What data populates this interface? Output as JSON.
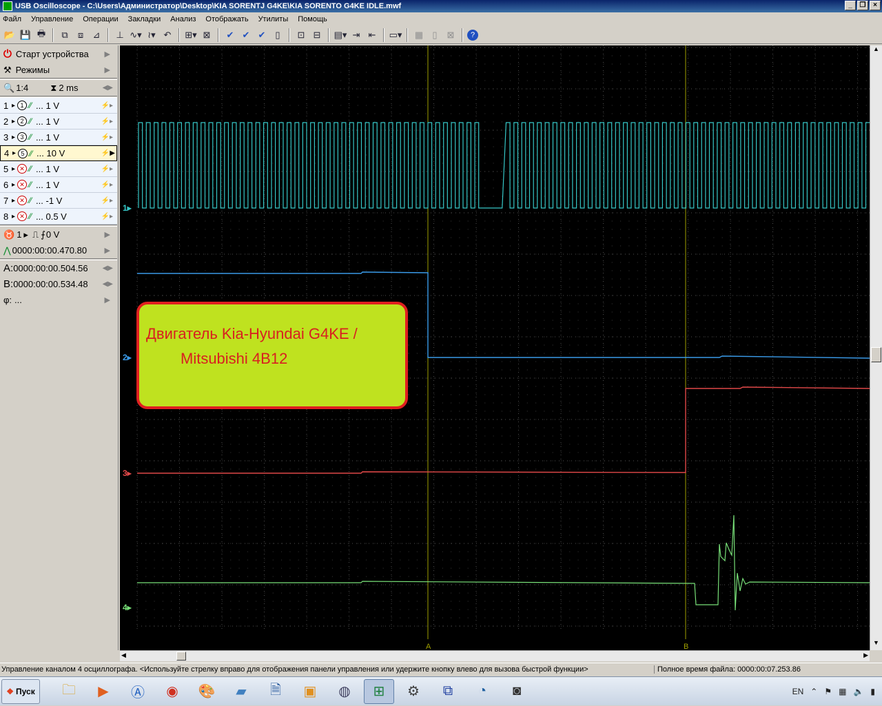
{
  "window": {
    "title": "USB Oscilloscope - C:\\Users\\Администратор\\Desktop\\KIA SORENTJ G4KE\\KIA SORENTO G4KE IDLE.mwf"
  },
  "menu": [
    "Файл",
    "Управление",
    "Операции",
    "Закладки",
    "Анализ",
    "Отображать",
    "Утилиты",
    "Помощь"
  ],
  "panel": {
    "start_label": "Старт устройства",
    "modes_label": "Режимы",
    "zoom": "1:4",
    "timebase": "2 ms",
    "channels": [
      {
        "num": "1",
        "probe": "1",
        "enabled": true,
        "scale": "... 1 V"
      },
      {
        "num": "2",
        "probe": "2",
        "enabled": true,
        "scale": "... 1 V"
      },
      {
        "num": "3",
        "probe": "3",
        "enabled": true,
        "scale": "... 1 V"
      },
      {
        "num": "4",
        "probe": "5",
        "enabled": true,
        "scale": "... 10 V",
        "selected": true
      },
      {
        "num": "5",
        "probe": "",
        "enabled": false,
        "scale": "... 1 V"
      },
      {
        "num": "6",
        "probe": "",
        "enabled": false,
        "scale": "... 1 V"
      },
      {
        "num": "7",
        "probe": "",
        "enabled": false,
        "scale": "... -1 V"
      },
      {
        "num": "8",
        "probe": "",
        "enabled": false,
        "scale": "... 0.5 V"
      }
    ],
    "trigger_channel": "1",
    "trigger_level": "0 V",
    "trigger_time": "0000:00:00.470.80",
    "cursor_a_label": "A:",
    "cursor_a": "0000:00:00.504.56",
    "cursor_b_label": "B:",
    "cursor_b": "0000:00:00.534.48",
    "phase_label": "φ:",
    "phase": "..."
  },
  "scope": {
    "trace_labels": [
      "1",
      "2",
      "3",
      "4"
    ],
    "trace_colors": [
      "#36c8c8",
      "#3a9ae8",
      "#e04848",
      "#78e078"
    ],
    "cursor_a_marker": "A",
    "cursor_b_marker": "B",
    "annotation_line1": "Двигатель Kia-Hyundai G4KE /",
    "annotation_line2": "Mitsubishi 4B12"
  },
  "status": {
    "message": "Управление каналом 4 осциллографа. <Используйте стрелку вправо для отображения панели управления или удержите кнопку влево для вызова быстрой функции>",
    "file_time": "Полное время файла: 0000:00:07.253.86"
  },
  "taskbar": {
    "start_label": "Пуск",
    "lang": "EN"
  }
}
